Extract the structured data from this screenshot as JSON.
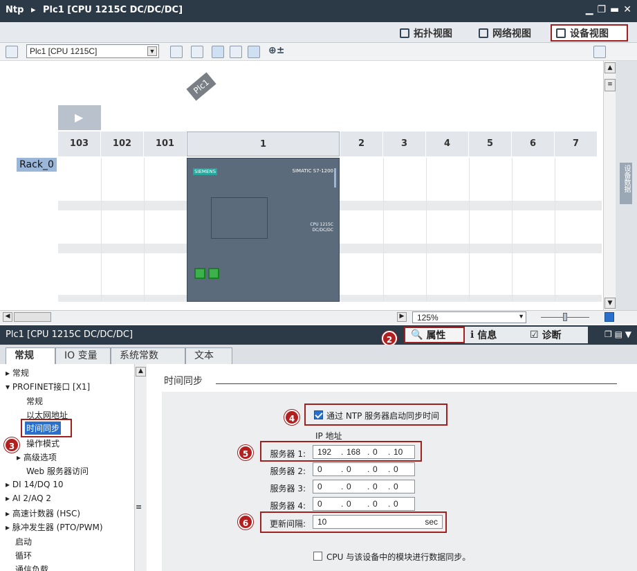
{
  "titlebar": {
    "project": "Ntp",
    "separator": "▸",
    "device": "Plc1 [CPU 1215C DC/DC/DC]"
  },
  "view_tabs": [
    {
      "label": "拓扑视图",
      "icon": "topology-icon"
    },
    {
      "label": "网络视图",
      "icon": "network-icon"
    },
    {
      "label": "设备视图",
      "icon": "device-icon",
      "active": true
    }
  ],
  "toolbar": {
    "device_select": "Plc1 [CPU 1215C]"
  },
  "device": {
    "label": "Plc1",
    "rack_label": "Rack_0",
    "slots": [
      "103",
      "102",
      "101",
      "1",
      "2",
      "3",
      "4",
      "5",
      "6",
      "7"
    ],
    "cpu_brand": "SIEMENS",
    "cpu_series": "SIMATIC S7-1200",
    "cpu_model": "CPU 1215C\nDC/DC/DC"
  },
  "zoom": {
    "value": "125%"
  },
  "side_panel": {
    "label": "设备数据"
  },
  "properties": {
    "title": "Plc1 [CPU 1215C DC/DC/DC]",
    "tabs": [
      {
        "label": "属性",
        "active": true
      },
      {
        "label": "信息"
      },
      {
        "label": "诊断"
      }
    ],
    "sub_tabs": [
      "常规",
      "IO 变量",
      "系统常数",
      "文本"
    ]
  },
  "nav": [
    {
      "label": "常规",
      "indent": 0,
      "arrow": "▸"
    },
    {
      "label": "PROFINET接口 [X1]",
      "indent": 0,
      "arrow": "▾"
    },
    {
      "label": "常规",
      "indent": 2,
      "arrow": ""
    },
    {
      "label": "以太网地址",
      "indent": 2,
      "arrow": ""
    },
    {
      "label": "时间同步",
      "indent": 2,
      "arrow": "",
      "selected": true
    },
    {
      "label": "操作模式",
      "indent": 2,
      "arrow": ""
    },
    {
      "label": "高级选项",
      "indent": 1,
      "arrow": "▸"
    },
    {
      "label": "Web 服务器访问",
      "indent": 2,
      "arrow": ""
    },
    {
      "label": "DI 14/DQ 10",
      "indent": 0,
      "arrow": "▸"
    },
    {
      "label": "AI 2/AQ 2",
      "indent": 0,
      "arrow": "▸"
    },
    {
      "label": "高速计数器 (HSC)",
      "indent": 0,
      "arrow": "▸"
    },
    {
      "label": "脉冲发生器 (PTO/PWM)",
      "indent": 0,
      "arrow": "▸"
    },
    {
      "label": "启动",
      "indent": 0,
      "arrow": ""
    },
    {
      "label": "循环",
      "indent": 0,
      "arrow": ""
    },
    {
      "label": "通信负载",
      "indent": 0,
      "arrow": ""
    }
  ],
  "time_sync": {
    "section_title": "时间同步",
    "enable_label": "通过 NTP 服务器启动同步时间",
    "enable_checked": true,
    "ip_header": "IP 地址",
    "servers": [
      {
        "label": "服务器 1:",
        "ip": [
          "192",
          "168",
          "0",
          "10"
        ]
      },
      {
        "label": "服务器 2:",
        "ip": [
          "0",
          "0",
          "0",
          "0"
        ]
      },
      {
        "label": "服务器 3:",
        "ip": [
          "0",
          "0",
          "0",
          "0"
        ]
      },
      {
        "label": "服务器 4:",
        "ip": [
          "0",
          "0",
          "0",
          "0"
        ]
      }
    ],
    "interval_label": "更新间隔:",
    "interval_value": "10",
    "interval_unit": "sec",
    "sync_label": "CPU 与该设备中的模块进行数据同步。",
    "sync_checked": false
  },
  "badges": [
    "1",
    "2",
    "3",
    "4",
    "5",
    "6"
  ],
  "colors": {
    "accent_red": "#a02020",
    "header": "#2c3a48",
    "cpu": "#5b6b7b"
  }
}
